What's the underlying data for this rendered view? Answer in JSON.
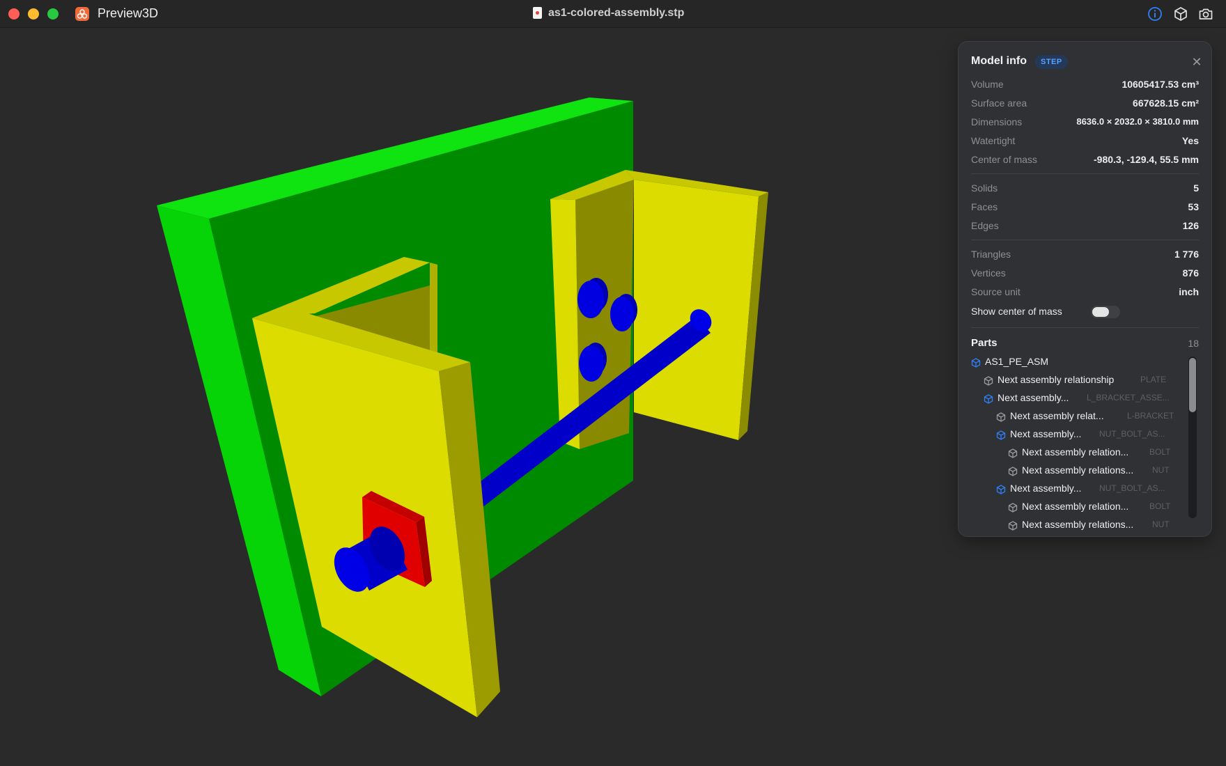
{
  "window": {
    "app_name": "Preview3D",
    "document_title": "as1-colored-assembly.stp",
    "toolbar_icons": [
      "info-icon",
      "cube-icon",
      "camera-icon"
    ]
  },
  "colors": {
    "plate": "#00d000",
    "bracket": "#dcdc00",
    "bolt": "#0000dd",
    "nut": "#dd0000",
    "accent": "#2f7ff7"
  },
  "panel": {
    "title": "Model info",
    "format_badge": "STEP",
    "close_icon": "close-icon",
    "properties": [
      {
        "label": "Volume",
        "value": "10605417.53 cm³"
      },
      {
        "label": "Surface area",
        "value": "667628.15 cm²"
      },
      {
        "label": "Dimensions",
        "value": "8636.0 × 2032.0 × 3810.0 mm"
      },
      {
        "label": "Watertight",
        "value": "Yes"
      },
      {
        "label": "Center of mass",
        "value": "-980.3, -129.4, 55.5 mm"
      }
    ],
    "topology": [
      {
        "label": "Solids",
        "value": "5"
      },
      {
        "label": "Faces",
        "value": "53"
      },
      {
        "label": "Edges",
        "value": "126"
      }
    ],
    "mesh": [
      {
        "label": "Triangles",
        "value": "1 776"
      },
      {
        "label": "Vertices",
        "value": "876"
      },
      {
        "label": "Source unit",
        "value": "inch"
      }
    ],
    "toggle": {
      "label": "Show center of mass",
      "on": false
    },
    "parts": {
      "title": "Parts",
      "count": "18",
      "items": [
        {
          "name": "AS1_PE_ASM",
          "tag": "",
          "kind": "assembly"
        },
        {
          "name": "Next assembly relationship",
          "tag": "PLATE",
          "kind": "part"
        },
        {
          "name": "Next assembly...",
          "tag": "L_BRACKET_ASSE...",
          "kind": "assembly"
        },
        {
          "name": "Next assembly relat...",
          "tag": "L-BRACKET",
          "kind": "part"
        },
        {
          "name": "Next assembly...",
          "tag": "NUT_BOLT_AS...",
          "kind": "assembly"
        },
        {
          "name": "Next assembly relation...",
          "tag": "BOLT",
          "kind": "part"
        },
        {
          "name": "Next assembly relations...",
          "tag": "NUT",
          "kind": "part"
        },
        {
          "name": "Next assembly...",
          "tag": "NUT_BOLT_AS...",
          "kind": "assembly"
        },
        {
          "name": "Next assembly relation...",
          "tag": "BOLT",
          "kind": "part"
        },
        {
          "name": "Next assembly relations...",
          "tag": "NUT",
          "kind": "part"
        }
      ]
    }
  }
}
